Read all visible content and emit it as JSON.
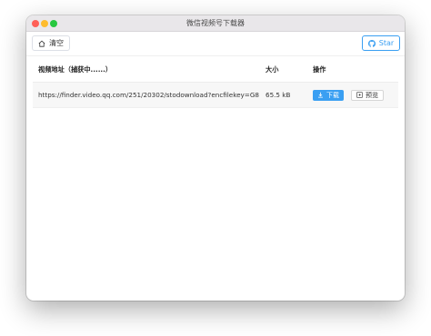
{
  "window": {
    "title": "微信视频号下载器"
  },
  "toolbar": {
    "clear_label": "清空",
    "star_label": "Star"
  },
  "table": {
    "headers": {
      "url": "视频地址（捕获中......）",
      "size": "大小",
      "actions": "操作"
    },
    "rows": [
      {
        "url": "https://finder.video.qq.com/251/20302/stodownload?encfilekey=G8",
        "size": "65.5 kB",
        "download_label": "下载",
        "preview_label": "预览"
      }
    ]
  },
  "colors": {
    "accent": "#3a9ff2"
  },
  "icons": [
    "home-icon",
    "github-icon",
    "download-icon",
    "play-icon"
  ]
}
